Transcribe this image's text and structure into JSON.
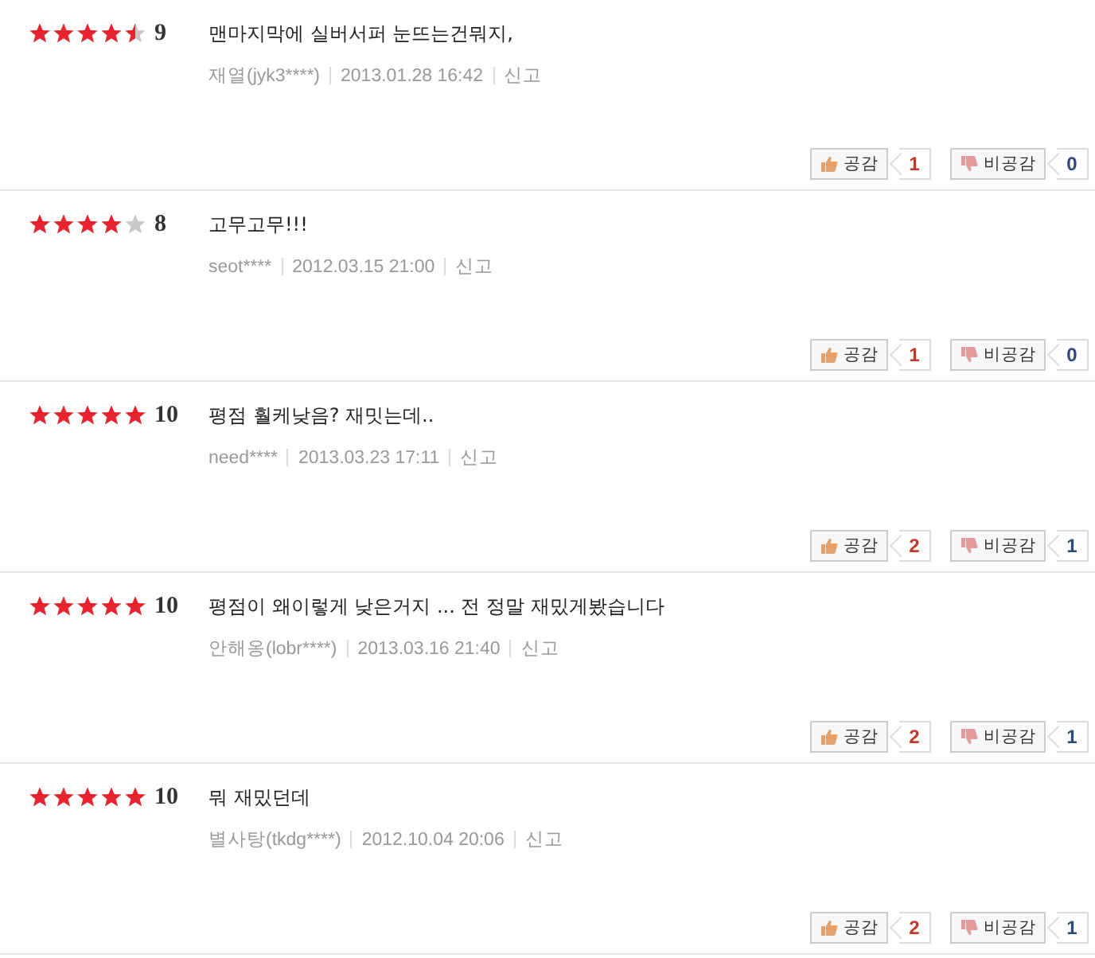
{
  "reviews": [
    {
      "stars": 4.5,
      "score": "9",
      "comment": "맨마지막에 실버서퍼 눈뜨는건뭐지,",
      "author": "재열(jyk3****)",
      "date": "2013.01.28 16:42",
      "report": "신고",
      "like_label": "공감",
      "like_count": "1",
      "dislike_label": "비공감",
      "dislike_count": "0"
    },
    {
      "stars": 4,
      "score": "8",
      "comment": "고무고무!!!",
      "author": "seot****",
      "date": "2012.03.15 21:00",
      "report": "신고",
      "like_label": "공감",
      "like_count": "1",
      "dislike_label": "비공감",
      "dislike_count": "0"
    },
    {
      "stars": 5,
      "score": "10",
      "comment": "평점 훨케낮음? 재밋는데..",
      "author": "need****",
      "date": "2013.03.23 17:11",
      "report": "신고",
      "like_label": "공감",
      "like_count": "2",
      "dislike_label": "비공감",
      "dislike_count": "1"
    },
    {
      "stars": 5,
      "score": "10",
      "comment": "평점이 왜이렇게 낮은거지 ... 전 정말 재밌게봤습니다",
      "author": "안해옹(lobr****)",
      "date": "2013.03.16 21:40",
      "report": "신고",
      "like_label": "공감",
      "like_count": "2",
      "dislike_label": "비공감",
      "dislike_count": "1"
    },
    {
      "stars": 5,
      "score": "10",
      "comment": "뭐 재밌던데",
      "author": "별사탕(tkdg****)",
      "date": "2012.10.04 20:06",
      "report": "신고",
      "like_label": "공감",
      "like_count": "2",
      "dislike_label": "비공감",
      "dislike_count": "1"
    }
  ]
}
